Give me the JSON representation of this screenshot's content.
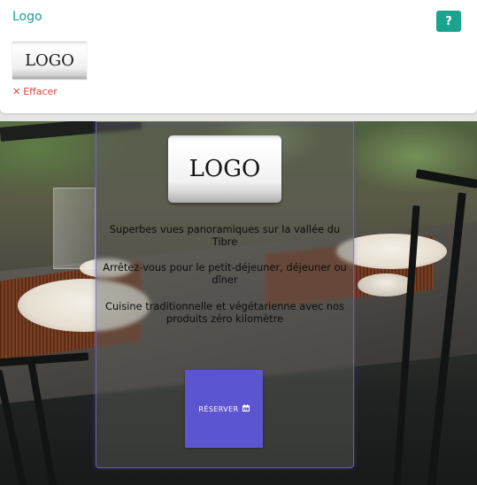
{
  "settings": {
    "title": "Logo",
    "help_label": "?",
    "logo_text": "LOGO",
    "clear_icon": "✕",
    "clear_label": "Effacer"
  },
  "preview": {
    "logo_text": "LOGO",
    "lines": [
      "Superbes vues panoramiques sur la vallée du Tibre",
      "Arrêtez-vous pour le petit-déjeuner, déjeuner ou dîner",
      "Cuisine traditionnelle et végétarienne avec nos produits zéro kilomètre"
    ],
    "button_label": "RÉSERVER",
    "button_icon": "calendar-icon",
    "button_color": "#5b55cf"
  },
  "colors": {
    "accent": "#1aa38f",
    "danger": "#e0423a"
  }
}
